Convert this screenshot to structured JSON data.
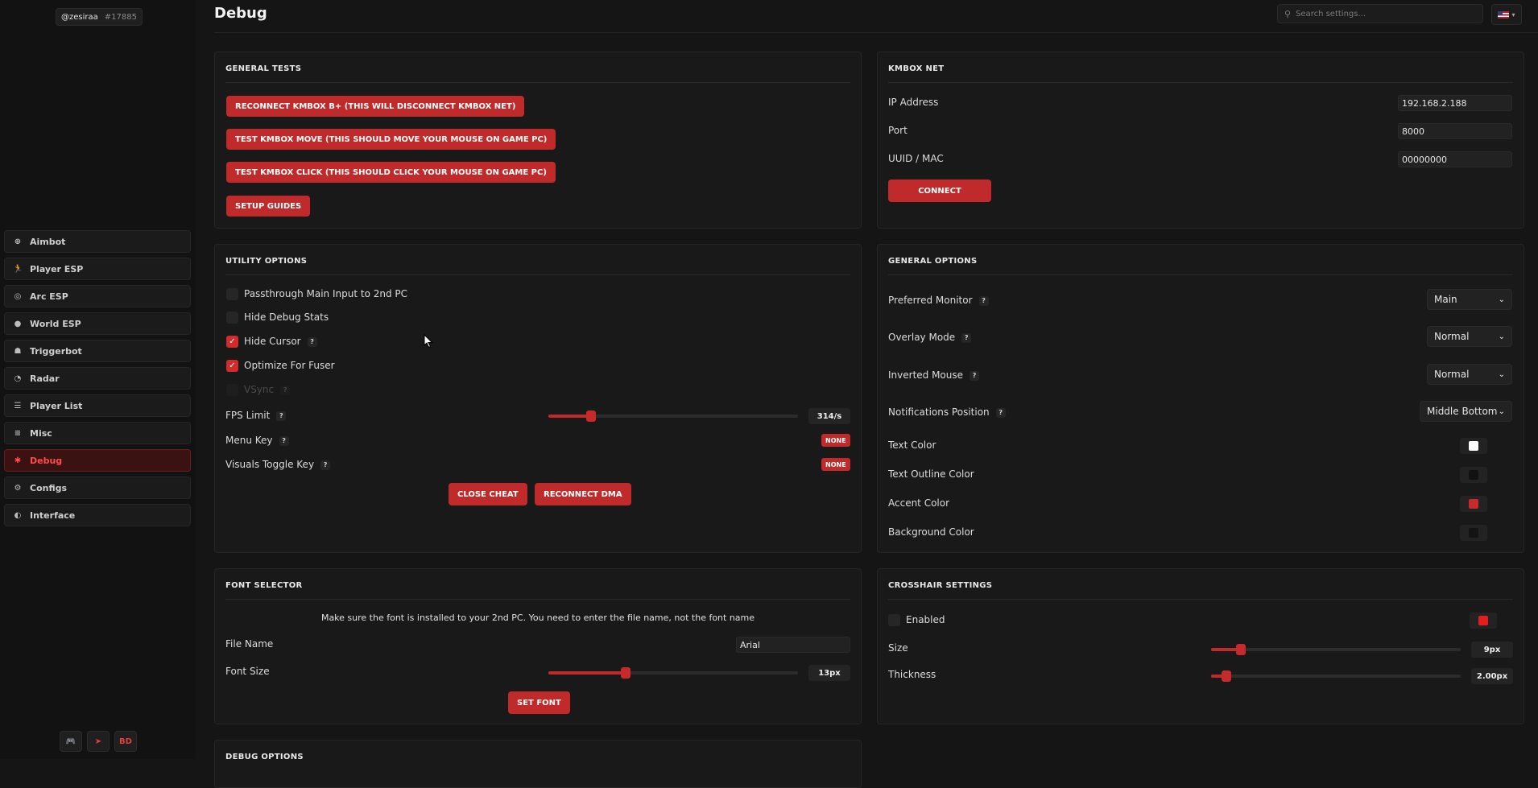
{
  "user": {
    "handle": "@zesiraa",
    "tag": "#17885"
  },
  "sidebar": {
    "items": [
      {
        "label": "Aimbot",
        "icon": "crosshair-icon",
        "glyph": "⊕"
      },
      {
        "label": "Player ESP",
        "icon": "running-person-icon",
        "glyph": "🏃"
      },
      {
        "label": "Arc ESP",
        "icon": "eye-slash-icon",
        "glyph": "◎"
      },
      {
        "label": "World ESP",
        "icon": "globe-icon",
        "glyph": "●"
      },
      {
        "label": "Triggerbot",
        "icon": "users-icon",
        "glyph": "☗"
      },
      {
        "label": "Radar",
        "icon": "radar-icon",
        "glyph": "◔"
      },
      {
        "label": "Player List",
        "icon": "list-icon",
        "glyph": "☰"
      },
      {
        "label": "Misc",
        "icon": "menu-icon",
        "glyph": "≡"
      },
      {
        "label": "Debug",
        "icon": "bug-icon",
        "glyph": "✱"
      },
      {
        "label": "Configs",
        "icon": "gear-icon",
        "glyph": "⚙"
      },
      {
        "label": "Interface",
        "icon": "palette-icon",
        "glyph": "◐"
      }
    ],
    "active": "Debug",
    "footer": {
      "game_icon": "gamepad-icon",
      "telegram_icon": "telegram-icon",
      "bd_label": "BD"
    }
  },
  "header": {
    "title": "Debug",
    "search_placeholder": "Search settings...",
    "language_flag": "us-flag-icon"
  },
  "general_tests": {
    "title": "GENERAL TESTS",
    "buttons": [
      "RECONNECT KMBOX B+ (THIS WILL DISCONNECT KMBOX NET)",
      "TEST KMBOX MOVE (THIS SHOULD MOVE YOUR MOUSE ON GAME PC)",
      "TEST KMBOX CLICK (THIS SHOULD CLICK YOUR MOUSE ON GAME PC)",
      "SETUP GUIDES"
    ]
  },
  "kmbox_net": {
    "title": "KMBOX NET",
    "ip_label": "IP Address",
    "ip_value": "192.168.2.188",
    "port_label": "Port",
    "port_value": "8000",
    "uuid_label": "UUID / MAC",
    "uuid_value": "00000000",
    "connect_label": "CONNECT"
  },
  "utility": {
    "title": "UTILITY OPTIONS",
    "passthrough": "Passthrough Main Input to 2nd PC",
    "hide_debug": "Hide Debug Stats",
    "hide_cursor": "Hide Cursor",
    "optimize": "Optimize For Fuser",
    "vsync": "VSync",
    "fps_label": "FPS Limit",
    "fps_value": "314/s",
    "fps_fraction": 0.17,
    "menu_key_label": "Menu Key",
    "menu_key_value": "NONE",
    "visuals_key_label": "Visuals Toggle Key",
    "visuals_key_value": "NONE",
    "close_label": "CLOSE CHEAT",
    "reconnect_label": "RECONNECT DMA",
    "q": "?"
  },
  "general_options": {
    "title": "GENERAL OPTIONS",
    "monitor_label": "Preferred Monitor",
    "monitor_value": "Main",
    "overlay_label": "Overlay Mode",
    "overlay_value": "Normal",
    "inverted_label": "Inverted Mouse",
    "inverted_value": "Normal",
    "notif_label": "Notifications Position",
    "notif_value": "Middle Bottom",
    "text_color_label": "Text Color",
    "text_color": "#ffffff",
    "outline_label": "Text Outline Color",
    "outline_color": "#111111",
    "accent_label": "Accent Color",
    "accent_color": "#c62a2a",
    "bg_label": "Background Color",
    "bg_color": "#141414"
  },
  "font_selector": {
    "title": "FONT SELECTOR",
    "note": "Make sure the font is installed to your 2nd PC. You need to enter the file name, not the font name",
    "file_label": "File Name",
    "file_value": "Arial",
    "size_label": "Font Size",
    "size_value": "13px",
    "size_fraction": 0.31,
    "set_label": "SET FONT"
  },
  "crosshair": {
    "title": "CROSSHAIR SETTINGS",
    "enabled_label": "Enabled",
    "color": "#e02020",
    "size_label": "Size",
    "size_value": "9px",
    "size_fraction": 0.12,
    "thickness_label": "Thickness",
    "thickness_value": "2.00px",
    "thickness_fraction": 0.06
  },
  "debug_options": {
    "title": "DEBUG OPTIONS"
  }
}
